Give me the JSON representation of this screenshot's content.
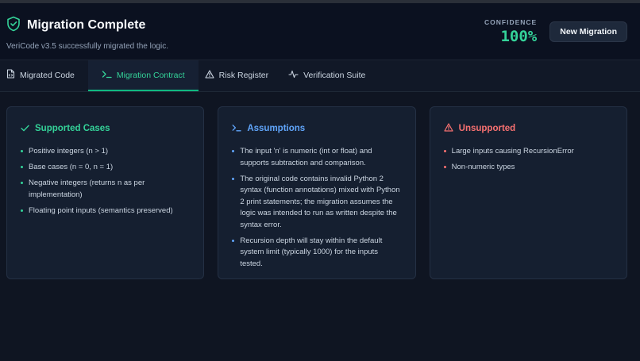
{
  "header": {
    "title": "Migration Complete",
    "subtitle": "VeriCode v3.5 successfully migrated the logic.",
    "confidence_label": "CONFIDENCE",
    "confidence_value": "100%",
    "new_migration_label": "New Migration"
  },
  "tabs": [
    {
      "label": "Migrated Code",
      "icon": "file-code-icon",
      "active": false
    },
    {
      "label": "Migration Contract",
      "icon": "terminal-icon",
      "active": true
    },
    {
      "label": "Risk Register",
      "icon": "warning-triangle-icon",
      "active": false
    },
    {
      "label": "Verification Suite",
      "icon": "activity-pulse-icon",
      "active": false
    }
  ],
  "cards": {
    "supported": {
      "title": "Supported Cases",
      "icon": "check-icon",
      "items": [
        "Positive integers (n > 1)",
        "Base cases (n = 0, n = 1)",
        "Negative integers (returns n as per implementation)",
        "Floating point inputs (semantics preserved)"
      ]
    },
    "assumptions": {
      "title": "Assumptions",
      "icon": "terminal-icon",
      "items": [
        "The input 'n' is numeric (int or float) and supports subtraction and comparison.",
        "The original code contains invalid Python 2 syntax (function annotations) mixed with Python 2 print statements; the migration assumes the logic was intended to run as written despite the syntax error.",
        "Recursion depth will stay within the default system limit (typically 1000) for the inputs tested."
      ]
    },
    "unsupported": {
      "title": "Unsupported",
      "icon": "warning-triangle-icon",
      "items": [
        "Large inputs causing RecursionError",
        "Non-numeric types"
      ]
    }
  },
  "colors": {
    "accent_green": "#34d399",
    "accent_blue": "#60a5fa",
    "accent_red": "#f87171",
    "background": "#0f1522"
  }
}
